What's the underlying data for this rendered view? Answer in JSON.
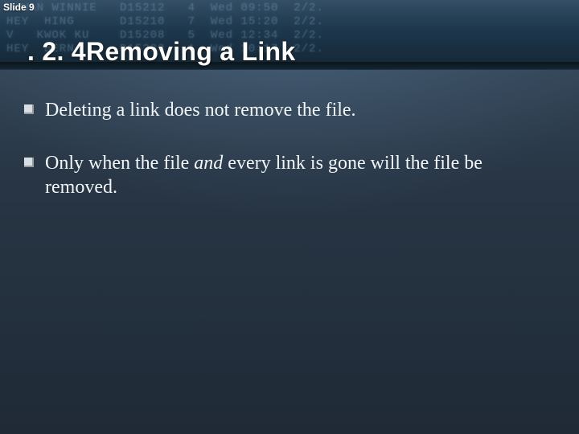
{
  "slide": {
    "number_label": "Slide 9",
    "title": ". 2. 4Removing a Link",
    "banner_rows": [
      "U WAN WINNIE   D15212   4  Wed 09:50  2/2.",
      "HEY  HING      D15210   7  Wed 15:20  2/2.",
      "V   KWOK KU    D15208   5  Wed 12:34  2/2.",
      "HEY  BERN     -D15223   1  Wed 10:17  2/2."
    ],
    "bullets": [
      {
        "pre": "Deleting a link does not remove the file.",
        "em": "",
        "post": ""
      },
      {
        "pre": "Only when the file ",
        "em": "and",
        "post": " every link is gone will the file be removed."
      }
    ]
  }
}
